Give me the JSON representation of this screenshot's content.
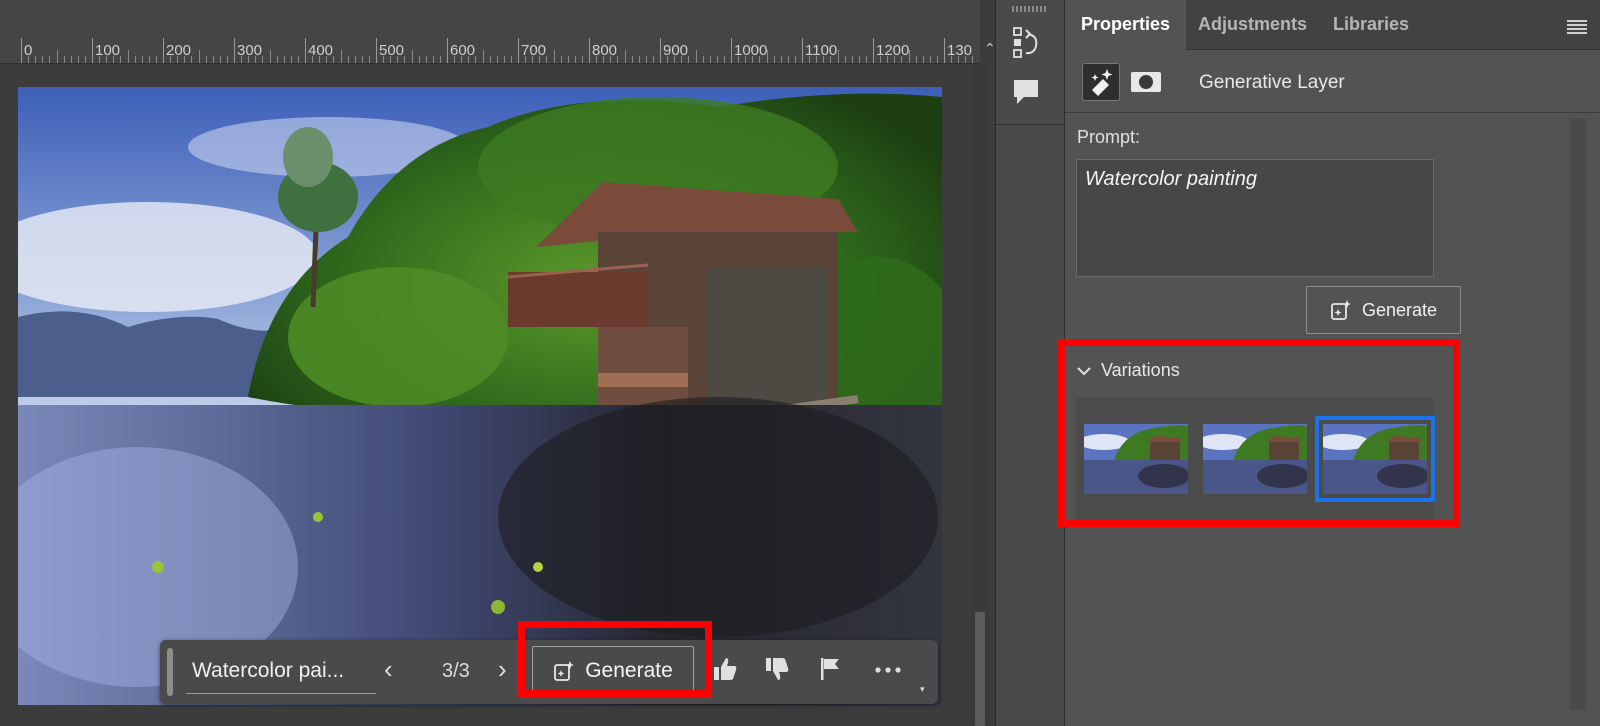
{
  "ruler": {
    "labels": [
      "0",
      "100",
      "200",
      "300",
      "400",
      "500",
      "600",
      "700",
      "800",
      "900",
      "1000",
      "1100",
      "1200",
      "130"
    ]
  },
  "taskbar": {
    "prompt_value": "Watercolor pai...",
    "counter": "3/3",
    "generate_label": "Generate"
  },
  "panel": {
    "tabs": [
      {
        "label": "Properties",
        "active": true
      },
      {
        "label": "Adjustments",
        "active": false
      },
      {
        "label": "Libraries",
        "active": false
      }
    ],
    "layer_name": "Generative Layer",
    "prompt_label": "Prompt:",
    "prompt_value": "Watercolor painting",
    "generate_label": "Generate",
    "variations_label": "Variations",
    "variations_selected": 3
  },
  "colors": {
    "highlight": "#ff0000",
    "selection": "#1a73e8"
  },
  "icons": {
    "history": "history-icon",
    "comments": "comment-icon",
    "generate": "generate-sparkle-icon",
    "like": "thumbs-up-icon",
    "dislike": "thumbs-down-icon",
    "report": "flag-icon",
    "more": "more-icon",
    "menu": "hamburger-menu-icon"
  }
}
